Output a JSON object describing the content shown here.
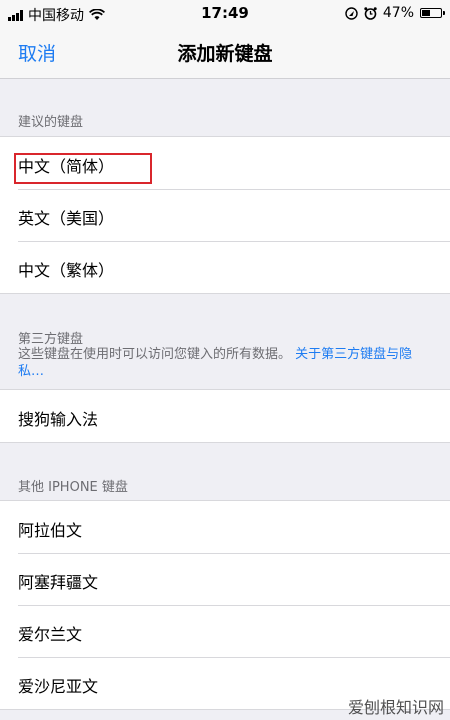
{
  "status_bar": {
    "carrier": "中国移动",
    "time": "17:49",
    "battery_text": "47%",
    "battery_level": 0.47,
    "icons": [
      "signal-icon",
      "wifi-icon",
      "location-icon",
      "alarm-icon",
      "battery-icon"
    ]
  },
  "nav": {
    "cancel_label": "取消",
    "title": "添加新键盘"
  },
  "suggested": {
    "header": "建议的键盘",
    "items": [
      {
        "label": "中文（简体）"
      },
      {
        "label": "英文（美国）"
      },
      {
        "label": "中文（繁体）"
      }
    ]
  },
  "third_party": {
    "header": "第三方键盘",
    "description": "这些键盘在使用时可以访问您键入的所有数据。",
    "link": "关于第三方键盘与隐私…",
    "items": [
      {
        "label": "搜狗输入法"
      }
    ]
  },
  "other": {
    "header": "其他 IPHONE 键盘",
    "items": [
      {
        "label": "阿拉伯文"
      },
      {
        "label": "阿塞拜疆文"
      },
      {
        "label": "爱尔兰文"
      },
      {
        "label": "爱沙尼亚文"
      }
    ]
  },
  "watermark": "爱刨根知识网",
  "colors": {
    "accent": "#1e7cf2",
    "highlight": "#d9262c",
    "background": "#efeff4"
  }
}
